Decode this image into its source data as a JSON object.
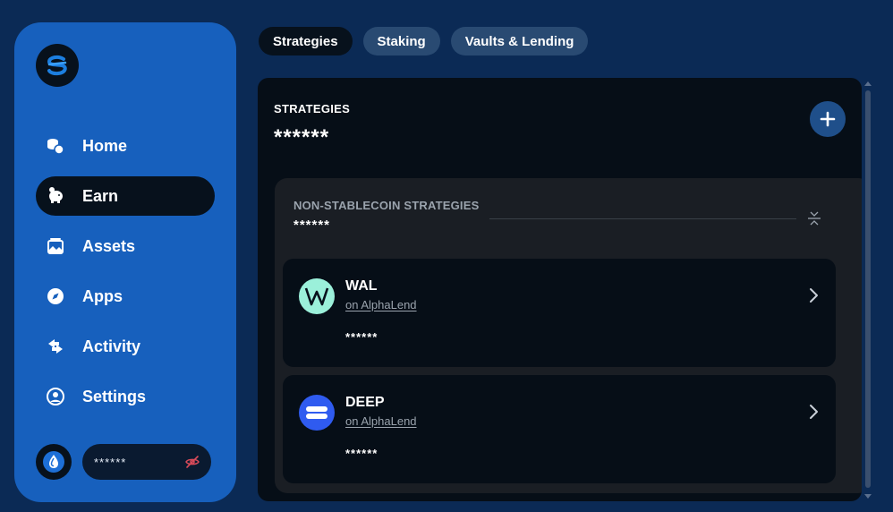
{
  "sidebar": {
    "logo_icon": "suiet-logo",
    "items": [
      {
        "label": "Home",
        "icon": "coins-icon",
        "active": false
      },
      {
        "label": "Earn",
        "icon": "piggy-bank-icon",
        "active": true
      },
      {
        "label": "Assets",
        "icon": "image-icon",
        "active": false
      },
      {
        "label": "Apps",
        "icon": "compass-icon",
        "active": false
      },
      {
        "label": "Activity",
        "icon": "transfer-icon",
        "active": false
      },
      {
        "label": "Settings",
        "icon": "user-circle-icon",
        "active": false
      }
    ],
    "wallet": {
      "avatar_icon": "droplet-icon",
      "masked_balance": "******",
      "toggle_icon": "eye-off-icon"
    }
  },
  "tabs": [
    {
      "label": "Strategies",
      "active": true
    },
    {
      "label": "Staking",
      "active": false
    },
    {
      "label": "Vaults & Lending",
      "active": false
    }
  ],
  "panel": {
    "title": "STRATEGIES",
    "value": "******",
    "add_icon": "plus-icon"
  },
  "group": {
    "title": "NON-STABLECOIN STRATEGIES",
    "value": "******",
    "collapse_icon": "collapse-icon",
    "cards": [
      {
        "token": "WAL",
        "source": "on AlphaLend",
        "value": "******",
        "icon": "wal-token-icon",
        "icon_color": "#9bf0da"
      },
      {
        "token": "DEEP",
        "source": "on AlphaLend",
        "value": "******",
        "icon": "deep-token-icon",
        "icon_color": "#2f5bf0"
      }
    ]
  },
  "colors": {
    "background": "#0b2a55",
    "sidebar": "#1760bd",
    "panel": "#060e17",
    "accent": "#1f4f8a"
  }
}
